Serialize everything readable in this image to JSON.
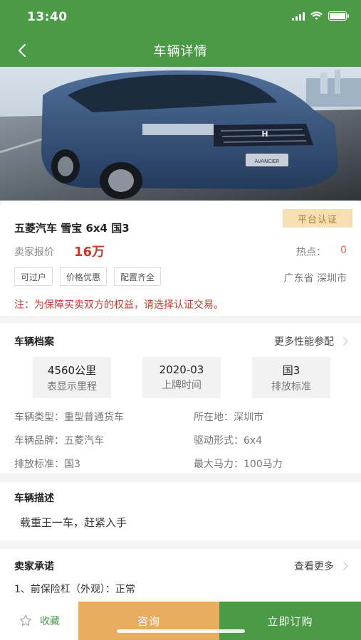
{
  "status_bar": {
    "time": "13:40"
  },
  "nav": {
    "title": "车辆详情"
  },
  "listing": {
    "badge": "平台认证",
    "title": "五菱汽车 雪宝 6x4 国3",
    "price_label": "卖家报价",
    "price_value": "16万",
    "hot_label": "热点：",
    "hot_value": "0",
    "tags": [
      "可过户",
      "价格优惠",
      "配置齐全"
    ],
    "location": "广东省 深圳市",
    "notice": "注：为保障买卖双方的权益，请选择认证交易。"
  },
  "profile": {
    "title": "车辆档案",
    "more": "更多性能参配",
    "stats": [
      {
        "value": "4560公里",
        "label": "表显示里程"
      },
      {
        "value": "2020-03",
        "label": "上牌时间"
      },
      {
        "value": "国3",
        "label": "排放标准"
      }
    ],
    "specs": {
      "type": "车辆类型：重型普通货车",
      "location": "所在地：深圳市",
      "brand": "车辆品牌：五菱汽车",
      "drive": "驱动形式：6x4",
      "emission": "排放标准：国3",
      "power": "最大马力：100马力"
    }
  },
  "description": {
    "title": "车辆描述",
    "text": "载重王一车，赶紧入手"
  },
  "promise": {
    "title": "卖家承诺",
    "more": "查看更多",
    "item": "1、前保险杠（外观）：正常"
  },
  "bottom": {
    "favorite": "收藏",
    "consult": "咨询",
    "order": "立即订购"
  },
  "colors": {
    "primary": "#4a9a46",
    "accent": "#e9ad62",
    "price": "#c83a2e",
    "badge_bg": "#f7dfb4"
  },
  "icons": {
    "back": "chevron-left-icon",
    "favorite": "star-outline-icon",
    "wifi": "wifi-icon",
    "battery": "battery-icon",
    "signal": "signal-icon"
  },
  "hero_image": {
    "brand_logo": "H",
    "plate": "AVANCIER"
  }
}
